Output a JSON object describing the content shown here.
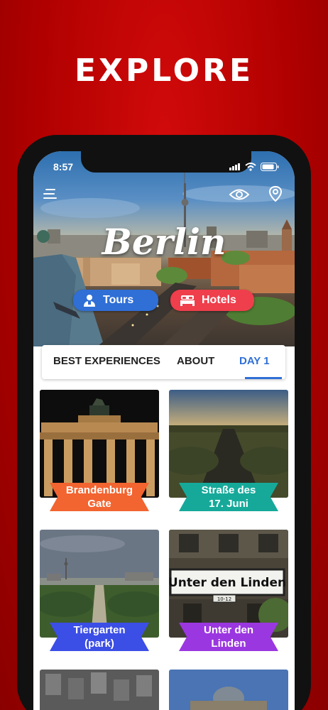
{
  "promo": {
    "title": "EXPLORE"
  },
  "status": {
    "time": "8:57"
  },
  "hero": {
    "city_name": "Berlin",
    "tours_label": "Tours",
    "hotels_label": "Hotels"
  },
  "tabs": [
    {
      "label": "BEST EXPERIENCES"
    },
    {
      "label": "ABOUT"
    },
    {
      "label": "DAY 1",
      "active": true
    }
  ],
  "cards": [
    {
      "title": "Brandenburg Gate",
      "line1": "Brandenburg",
      "line2": "Gate",
      "ribbon_color": "#f26430"
    },
    {
      "title": "Straße des 17. Juni",
      "line1": "Straße des",
      "line2": "17. Juni",
      "ribbon_color": "#16a99a"
    },
    {
      "title": "Tiergarten (park)",
      "line1": "Tiergarten",
      "line2": "(park)",
      "ribbon_color": "#3b4ee6"
    },
    {
      "title": "Unter den Linden",
      "line1": "Unter den",
      "line2": "Linden",
      "ribbon_color": "#9b37e0"
    }
  ],
  "signs": {
    "unter_den_linden": "Unter den Linden",
    "sign_number": "10-12"
  },
  "colors": {
    "accent_blue": "#2f6fd6",
    "accent_red": "#ef3e4c",
    "background_red": "#c20a0a"
  }
}
